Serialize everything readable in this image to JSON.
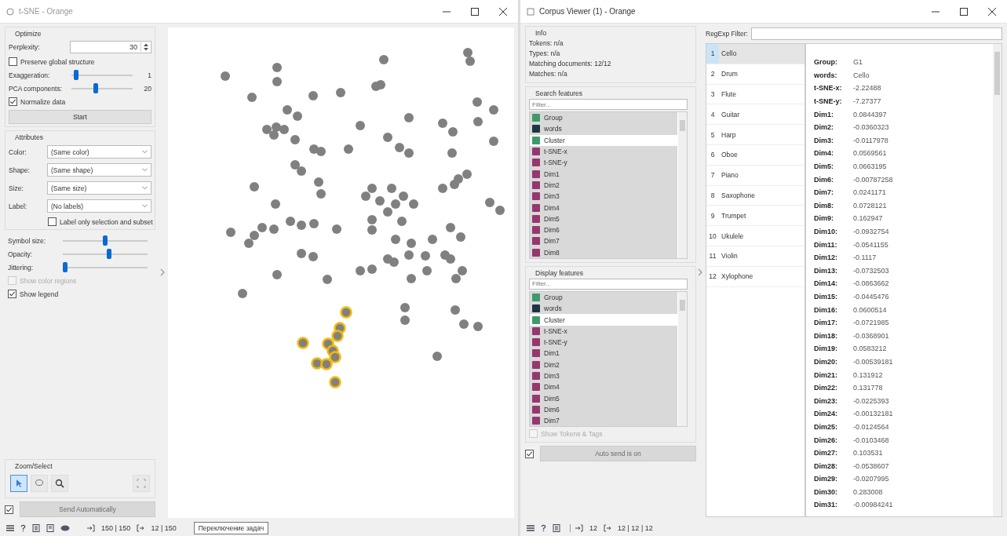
{
  "tsne_window": {
    "title": "t-SNE - Orange",
    "optimize": {
      "title": "Optimize",
      "perplexity": {
        "label": "Perplexity:",
        "value": "30"
      },
      "preserve_global": {
        "label": "Preserve global structure",
        "checked": false
      },
      "sliders": [
        {
          "label": "Exaggeration:",
          "level": 0.08,
          "reading": "1"
        },
        {
          "label": "PCA components:",
          "level": 0.4,
          "reading": "20"
        }
      ],
      "normalize": {
        "label": "Normalize data",
        "checked": true
      },
      "start_button": "Start"
    },
    "attributes": {
      "title": "Attributes",
      "dropdowns": [
        {
          "label": "Color:",
          "value": "(Same color)"
        },
        {
          "label": "Shape:",
          "value": "(Same shape)"
        },
        {
          "label": "Size:",
          "value": "(Same size)"
        },
        {
          "label": "Label:",
          "value": "(No labels)"
        }
      ],
      "label_only": {
        "label": "Label only selection and subset",
        "checked": false
      }
    },
    "display_sliders": [
      {
        "label": "Symbol size:",
        "level": 0.5
      },
      {
        "label": "Opacity:",
        "level": 0.55
      },
      {
        "label": "Jittering:",
        "level": 0.03
      }
    ],
    "show_color_regions": {
      "label": "Show color regions",
      "checked": false,
      "disabled": true
    },
    "show_legend": {
      "label": "Show legend",
      "checked": true,
      "disabled": false
    },
    "zoom_select": {
      "title": "Zoom/Select",
      "tools": [
        {
          "kind": "pointer",
          "selected": true
        },
        {
          "kind": "lasso",
          "selected": false
        },
        {
          "kind": "zoom",
          "selected": false
        },
        {
          "kind": "fit",
          "selected": false
        }
      ]
    },
    "send_automatically": {
      "label": "Send Automatically",
      "checked": true
    },
    "status_bar": {
      "input_count": "150 | 150",
      "output_count": "12 | 150",
      "tooltip": "Переключение задач"
    }
  },
  "corpus_window": {
    "title": "Corpus Viewer (1) - Orange",
    "info": {
      "title": "Info",
      "lines": [
        "Tokens: n/a",
        "Types: n/a",
        "Matching documents: 12/12",
        "Matches: n/a"
      ]
    },
    "search_features": {
      "title": "Search features",
      "placeholder": "Filter...",
      "items": [
        {
          "name": "Group",
          "kind": "categorical",
          "selected": true
        },
        {
          "name": "words",
          "kind": "string",
          "selected": true
        },
        {
          "name": "Cluster",
          "kind": "categorical",
          "selected": false
        },
        {
          "name": "t-SNE-x",
          "kind": "numeric",
          "selected": true
        },
        {
          "name": "t-SNE-y",
          "kind": "numeric",
          "selected": true
        },
        {
          "name": "Dim1",
          "kind": "numeric",
          "selected": true
        },
        {
          "name": "Dim2",
          "kind": "numeric",
          "selected": true
        },
        {
          "name": "Dim3",
          "kind": "numeric",
          "selected": true
        },
        {
          "name": "Dim4",
          "kind": "numeric",
          "selected": true
        },
        {
          "name": "Dim5",
          "kind": "numeric",
          "selected": true
        },
        {
          "name": "Dim6",
          "kind": "numeric",
          "selected": true
        },
        {
          "name": "Dim7",
          "kind": "numeric",
          "selected": true
        },
        {
          "name": "Dim8",
          "kind": "numeric",
          "selected": true
        }
      ]
    },
    "display_features": {
      "title": "Display features",
      "placeholder": "Filter...",
      "items": [
        {
          "name": "Group",
          "kind": "categorical",
          "selected": true
        },
        {
          "name": "words",
          "kind": "string",
          "selected": true
        },
        {
          "name": "Cluster",
          "kind": "categorical",
          "selected": false
        },
        {
          "name": "t-SNE-x",
          "kind": "numeric",
          "selected": true
        },
        {
          "name": "t-SNE-y",
          "kind": "numeric",
          "selected": true
        },
        {
          "name": "Dim1",
          "kind": "numeric",
          "selected": true
        },
        {
          "name": "Dim2",
          "kind": "numeric",
          "selected": true
        },
        {
          "name": "Dim3",
          "kind": "numeric",
          "selected": true
        },
        {
          "name": "Dim4",
          "kind": "numeric",
          "selected": true
        },
        {
          "name": "Dim5",
          "kind": "numeric",
          "selected": true
        },
        {
          "name": "Dim6",
          "kind": "numeric",
          "selected": true
        },
        {
          "name": "Dim7",
          "kind": "numeric",
          "selected": true
        }
      ]
    },
    "show_tokens": {
      "label": "Show Tokens & Tags",
      "checked": false,
      "disabled": true
    },
    "auto_send": {
      "label": "Auto send is on",
      "checked": true
    },
    "regexp_filter": {
      "label": "RegExp Filter:"
    },
    "documents": [
      {
        "number": "1",
        "title": "Cello",
        "selected": true
      },
      {
        "number": "2",
        "title": "Drum",
        "selected": false
      },
      {
        "number": "3",
        "title": "Flute",
        "selected": false
      },
      {
        "number": "4",
        "title": "Guitar",
        "selected": false
      },
      {
        "number": "5",
        "title": "Harp",
        "selected": false
      },
      {
        "number": "6",
        "title": "Oboe",
        "selected": false
      },
      {
        "number": "7",
        "title": "Piano",
        "selected": false
      },
      {
        "number": "8",
        "title": "Saxophone",
        "selected": false
      },
      {
        "number": "9",
        "title": "Trumpet",
        "selected": false
      },
      {
        "number": "10",
        "title": "Ukulele",
        "selected": false
      },
      {
        "number": "11",
        "title": "Violin",
        "selected": false
      },
      {
        "number": "12",
        "title": "Xylophone",
        "selected": false
      }
    ],
    "fields": [
      {
        "name": "Group:",
        "value": "G1"
      },
      {
        "name": "words:",
        "value": "Cello"
      },
      {
        "name": "t-SNE-x:",
        "value": "-2.22488"
      },
      {
        "name": "t-SNE-y:",
        "value": "-7.27377"
      },
      {
        "name": "Dim1:",
        "value": "0.0844397"
      },
      {
        "name": "Dim2:",
        "value": "-0.0360323"
      },
      {
        "name": "Dim3:",
        "value": "-0.0117978"
      },
      {
        "name": "Dim4:",
        "value": "0.0569561"
      },
      {
        "name": "Dim5:",
        "value": "0.0663195"
      },
      {
        "name": "Dim6:",
        "value": "-0.00787258"
      },
      {
        "name": "Dim7:",
        "value": "0.0241171"
      },
      {
        "name": "Dim8:",
        "value": "0.0728121"
      },
      {
        "name": "Dim9:",
        "value": "0.162947"
      },
      {
        "name": "Dim10:",
        "value": "-0.0932754"
      },
      {
        "name": "Dim11:",
        "value": "-0.0541155"
      },
      {
        "name": "Dim12:",
        "value": "-0.1117"
      },
      {
        "name": "Dim13:",
        "value": "-0.0732503"
      },
      {
        "name": "Dim14:",
        "value": "-0.0863662"
      },
      {
        "name": "Dim15:",
        "value": "-0.0445476"
      },
      {
        "name": "Dim16:",
        "value": "0.0600514"
      },
      {
        "name": "Dim17:",
        "value": "-0.0721985"
      },
      {
        "name": "Dim18:",
        "value": "-0.0368901"
      },
      {
        "name": "Dim19:",
        "value": "0.0583212"
      },
      {
        "name": "Dim20:",
        "value": "-0.00539181"
      },
      {
        "name": "Dim21:",
        "value": "0.131912"
      },
      {
        "name": "Dim22:",
        "value": "0.131778"
      },
      {
        "name": "Dim23:",
        "value": "-0.0225393"
      },
      {
        "name": "Dim24:",
        "value": "-0.00132181"
      },
      {
        "name": "Dim25:",
        "value": "-0.0124564"
      },
      {
        "name": "Dim26:",
        "value": "-0.0103468"
      },
      {
        "name": "Dim27:",
        "value": "0.103531"
      },
      {
        "name": "Dim28:",
        "value": "-0.0538607"
      },
      {
        "name": "Dim29:",
        "value": "-0.0207995"
      },
      {
        "name": "Dim30:",
        "value": "0.283008"
      },
      {
        "name": "Dim31:",
        "value": "-0.00984241"
      }
    ],
    "status_bar": {
      "input_count": "12",
      "output_count": "12 | 12 | 12"
    }
  }
}
